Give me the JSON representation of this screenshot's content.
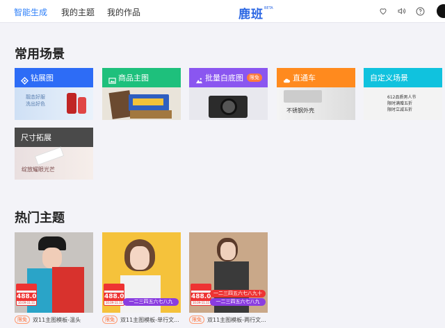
{
  "header": {
    "nav": [
      "智能生成",
      "我的主题",
      "我的作品"
    ],
    "logo": "鹿班",
    "logo_beta": "BETA",
    "icons": [
      "heart-icon",
      "speaker-icon",
      "help-icon"
    ]
  },
  "sections": {
    "scenes_title": "常用场景",
    "themes_title": "热门主题"
  },
  "scenes": [
    {
      "title": "钻展图",
      "color": "#2d6cf6",
      "icon": "diamond-icon",
      "caption_line1": "靓态好服",
      "caption_line2": "洗出好色"
    },
    {
      "title": "商品主图",
      "color": "#1ec07c",
      "icon": "image-icon"
    },
    {
      "title": "批量白底图",
      "color": "#8a56f0",
      "icon": "mountain-icon",
      "badge": "限免"
    },
    {
      "title": "直通车",
      "color": "#ff8a1e",
      "icon": "cloud-icon",
      "caption_line1": "不锈钢外壳"
    },
    {
      "title": "自定义场景",
      "color": "#10c2de",
      "icon": "",
      "caption_line1": "612品质男人节",
      "caption_line2": "限时满赠五折",
      "caption_line3": "限时立减五折"
    },
    {
      "title": "尺寸拓展",
      "color": "#4a4a4a",
      "icon": "",
      "caption_line1": "绽放耀眼光芒"
    }
  ],
  "themes": [
    {
      "price": "488.0",
      "price_sub": "10.09-11.11",
      "caption": "双11主图模板-温头",
      "tag": "限免"
    },
    {
      "price": "488.0",
      "price_sub": "10.09-11.11",
      "ribbon": "一二三四五六七八九",
      "caption": "双11主图模板-单行文...",
      "tag": "限免"
    },
    {
      "price": "488.0",
      "price_sub": "10.09-11.11",
      "ribbon": "一二三四五六七八九十",
      "ribbon2": "一二三四五六七八九",
      "caption": "双11主图模板-两行文...",
      "tag": "限免"
    }
  ]
}
